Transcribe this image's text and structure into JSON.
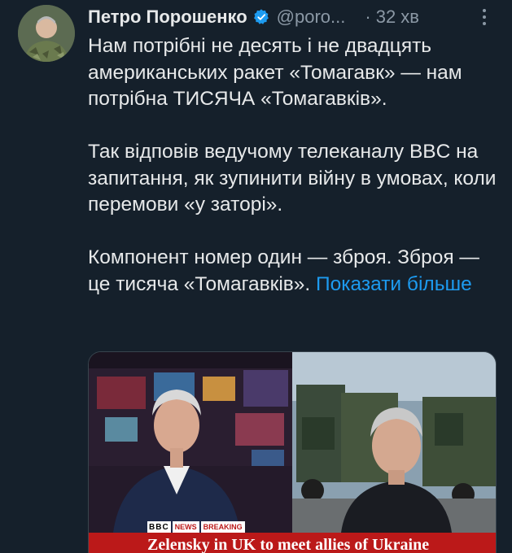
{
  "tweet": {
    "author_name": "Петро Порошенко",
    "handle": "@poro...",
    "separator": "·",
    "time": "32 хв",
    "paragraphs": [
      "Нам потрібні не десять і не двадцять американських ракет «Томагавк» — нам потрібна ТИСЯЧА «Томагавків».",
      "Так відповів ведучому телеканалу BBC на запитання, як зупинити війну в умовах, коли перемови «у заторі».",
      "Компонент номер один — зброя. Зброя — це тисяча «Томагавків». "
    ],
    "show_more": "Показати більше"
  },
  "media": {
    "bbc_logo": "BBC",
    "news_label": "NEWS",
    "breaking_label": "BREAKING",
    "headline": "Zelensky in UK to meet allies of Ukraine"
  },
  "colors": {
    "background": "#15202b",
    "text": "#e7e9ea",
    "secondary_text": "#8b98a5",
    "link": "#1d9bf0",
    "verified": "#1d9bf0",
    "bbc_red": "#bb1919"
  },
  "icons": {
    "verified": "verified-badge-icon",
    "more": "more-options-icon"
  }
}
